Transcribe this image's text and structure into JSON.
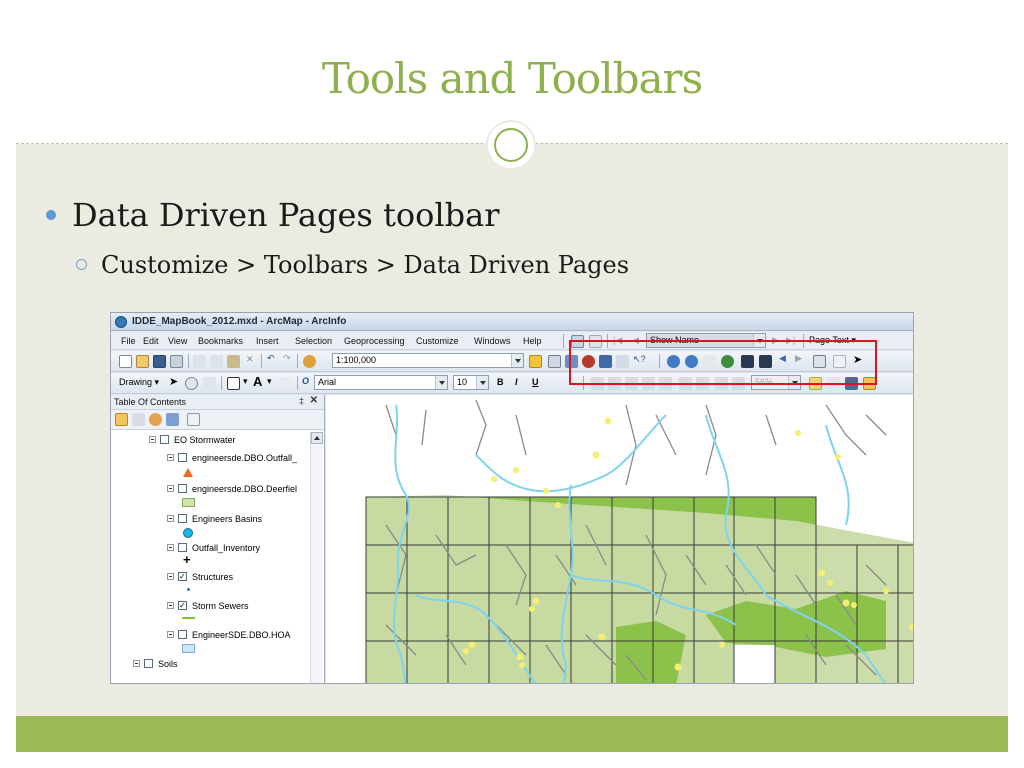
{
  "slide": {
    "title": "Tools and Toolbars",
    "bullet_1": "Data Driven Pages toolbar",
    "bullet_2": "Customize > Toolbars > Data Driven Pages",
    "accent_color": "#9bbb59",
    "title_color": "#8fb04f"
  },
  "window": {
    "title": "IDDE_MapBook_2012.mxd - ArcMap - ArcInfo"
  },
  "menu": [
    "File",
    "Edit",
    "View",
    "Bookmarks",
    "Insert",
    "Selection",
    "Geoprocessing",
    "Customize",
    "Windows",
    "Help"
  ],
  "standard_toolbar": {
    "scale": "1:100,000"
  },
  "data_driven_pages_toolbar": {
    "page_name_field": "Show Name",
    "page_text_button": "Page Text"
  },
  "drawing_toolbar": {
    "drawing_menu": "Drawing",
    "font_name": "Arial",
    "font_size": "10",
    "bold": "B",
    "italic": "I",
    "underline": "U"
  },
  "layout_toolbar": {
    "zoom_percent": "56%"
  },
  "toc": {
    "header": "Table Of Contents",
    "pin": "‡",
    "close": "✕",
    "layers": [
      {
        "label": "EO Stormwater",
        "checked": false
      },
      {
        "label": "engineersde.DBO.Outfall_",
        "checked": false
      },
      {
        "label": "engineersde.DBO.Deerfiel",
        "checked": false
      },
      {
        "label": "Engineers Basins",
        "checked": false
      },
      {
        "label": "Outfall_Inventory",
        "checked": false
      },
      {
        "label": "Structures",
        "checked": true
      },
      {
        "label": "Storm Sewers",
        "checked": true
      },
      {
        "label": "EngineerSDE.DBO.HOA",
        "checked": false
      },
      {
        "label": "Soils",
        "checked": false
      }
    ],
    "symbols": {
      "outfall": "triangle-orange",
      "deerfield": "square-lightgreen",
      "basins": "circle-blue",
      "outfall_inventory": "plus-black",
      "structures": "dot-blue",
      "storm_sewers": "line-green",
      "hoa": "square-lightblue"
    }
  },
  "map": {
    "grid_color": "#3a3a3a",
    "dark_fill": "#8dc24a",
    "light_fill": "#c9dba6",
    "stream_color": "#7ed3ee",
    "road_color": "#8a8a8a",
    "structure_color": "#f4ef72"
  }
}
